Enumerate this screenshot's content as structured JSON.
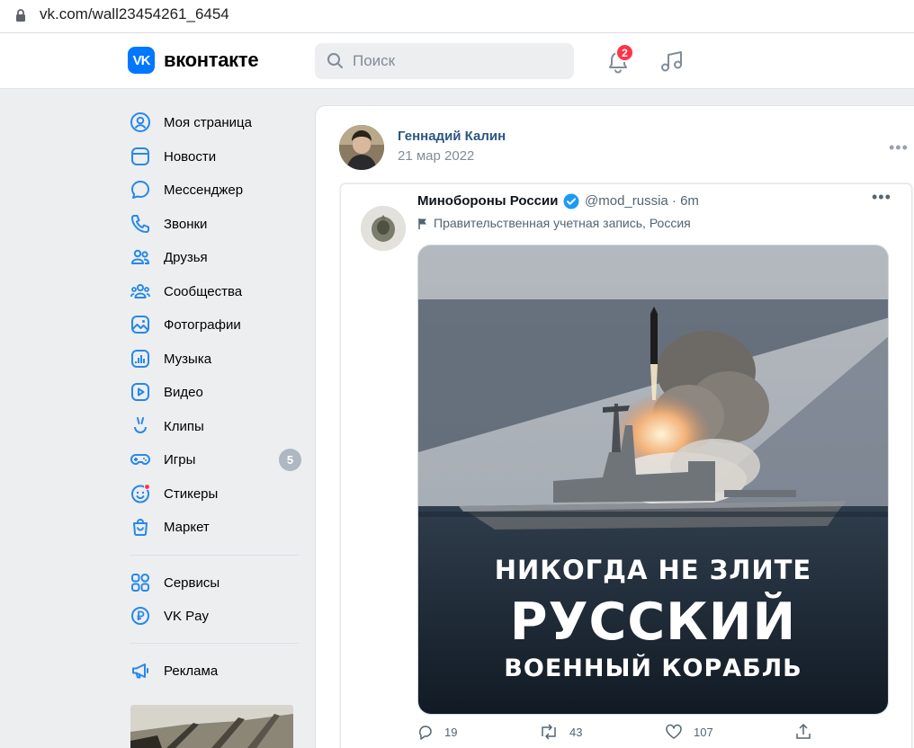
{
  "browser": {
    "url": "vk.com/wall23454261_6454"
  },
  "header": {
    "logo_text": "вконтакте",
    "logo_mark": "VK",
    "search_placeholder": "Поиск",
    "notifications_count": "2"
  },
  "sidebar": {
    "items": [
      {
        "label": "Моя страница",
        "icon": "user-circle-icon"
      },
      {
        "label": "Новости",
        "icon": "news-icon"
      },
      {
        "label": "Мессенджер",
        "icon": "message-icon"
      },
      {
        "label": "Звонки",
        "icon": "phone-icon"
      },
      {
        "label": "Друзья",
        "icon": "friends-icon"
      },
      {
        "label": "Сообщества",
        "icon": "communities-icon"
      },
      {
        "label": "Фотографии",
        "icon": "photos-icon"
      },
      {
        "label": "Музыка",
        "icon": "music-icon"
      },
      {
        "label": "Видео",
        "icon": "video-icon"
      },
      {
        "label": "Клипы",
        "icon": "clips-icon"
      },
      {
        "label": "Игры",
        "icon": "games-icon",
        "badge": "5"
      },
      {
        "label": "Стикеры",
        "icon": "stickers-icon"
      },
      {
        "label": "Маркет",
        "icon": "market-icon"
      }
    ],
    "services_label": "Сервисы",
    "pay_label": "VK Pay",
    "ads_label": "Реклама"
  },
  "post": {
    "author": "Геннадий Калин",
    "date": "21 мар 2022",
    "more": "•••"
  },
  "tweet": {
    "name": "Минобороны России",
    "handle": "@mod_russia · 6m",
    "label": "Правительственная учетная запись, Россия",
    "more": "•••",
    "image_caption_1": "НИКОГДА НЕ ЗЛИТЕ",
    "image_caption_2": "РУССКИЙ",
    "image_caption_3": "ВОЕННЫЙ КОРАБЛЬ",
    "replies": "19",
    "retweets": "43",
    "likes": "107"
  },
  "colors": {
    "vk_blue": "#0077ff",
    "link": "#2a5885",
    "badge_red": "#ff3347",
    "twitter_verified": "#1d9bf0"
  }
}
